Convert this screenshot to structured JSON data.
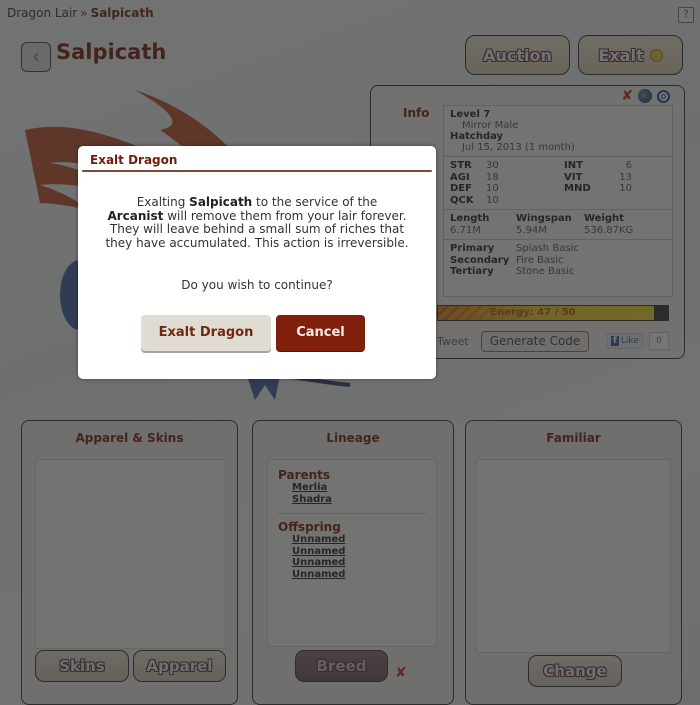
{
  "breadcrumb": {
    "parent": "Dragon Lair",
    "separator": "»",
    "current": "Salpicath"
  },
  "help_label": "?",
  "back_icon": "‹",
  "page_title": "Salpicath",
  "top_buttons": {
    "auction": "Auction",
    "exalt": "Exalt"
  },
  "info_panel": {
    "label": "Info",
    "icons": [
      "breed-cooldown-icon",
      "element-orb-icon",
      "gender-male-icon"
    ],
    "level": "Level 7",
    "breed_gender": "Mirror Male",
    "hatchday_label": "Hatchday",
    "hatchday": "Jul 15, 2013 (1 month)",
    "stats": [
      {
        "name": "STR",
        "value": "30"
      },
      {
        "name": "INT",
        "value": "6"
      },
      {
        "name": "AGI",
        "value": "18"
      },
      {
        "name": "VIT",
        "value": "13"
      },
      {
        "name": "DEF",
        "value": "10"
      },
      {
        "name": "MND",
        "value": "10"
      },
      {
        "name": "QCK",
        "value": "10"
      }
    ],
    "dimensions": {
      "length_label": "Length",
      "length": "6.71M",
      "wingspan_label": "Wingspan",
      "wingspan": "5.94M",
      "weight_label": "Weight",
      "weight": "536.87KG"
    },
    "genes": {
      "primary_label": "Primary",
      "primary": "Splash Basic",
      "secondary_label": "Secondary",
      "secondary": "Fire Basic",
      "tertiary_label": "Tertiary",
      "tertiary": "Stone Basic"
    },
    "energy": {
      "text": "Energy: 47 / 50",
      "current": 47,
      "max": 50
    },
    "tweet_label": "Tweet",
    "generate_code_label": "Generate Code",
    "fb_like_label": "Like",
    "fb_like_count": "0"
  },
  "panels": {
    "apparel": {
      "title": "Apparel & Skins",
      "skins_btn": "Skins",
      "apparel_btn": "Apparel"
    },
    "lineage": {
      "title": "Lineage",
      "parents_label": "Parents",
      "parents": [
        "Merlia",
        "Shadra"
      ],
      "offspring_label": "Offspring",
      "offspring": [
        "Unnamed",
        "Unnamed",
        "Unnamed",
        "Unnamed"
      ],
      "breed_btn": "Breed"
    },
    "familiar": {
      "title": "Familiar",
      "change_btn": "Change"
    }
  },
  "modal": {
    "title": "Exalt Dragon",
    "body_pre": "Exalting ",
    "body_dragon": "Salpicath",
    "body_mid": " to the service of the ",
    "body_entity": "Arcanist",
    "body_post": " will remove them from your lair forever. They will leave behind a small sum of riches that they have accumulated. This action is irreversible.",
    "question": "Do you wish to continue?",
    "confirm_label": "Exalt Dragon",
    "cancel_label": "Cancel"
  },
  "colors": {
    "accent": "#731d08",
    "cancel_bg": "#7f1f0c",
    "confirm_bg": "#e0dcd3"
  }
}
